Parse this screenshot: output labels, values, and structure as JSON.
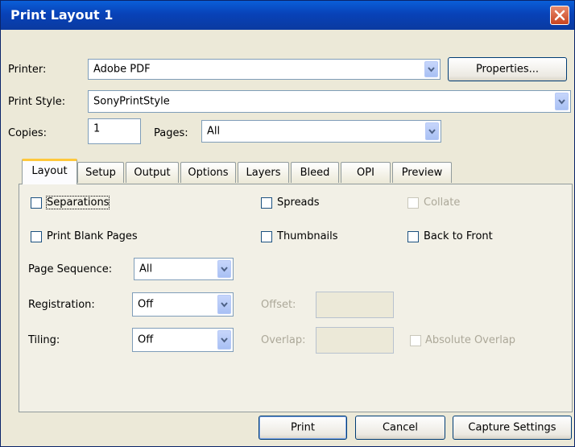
{
  "window": {
    "title": "Print Layout 1"
  },
  "printer": {
    "label": "Printer:",
    "value": "Adobe PDF",
    "properties_label": "Properties..."
  },
  "print_style": {
    "label": "Print Style:",
    "value": "SonyPrintStyle"
  },
  "copies": {
    "label": "Copies:",
    "value": "1"
  },
  "pages": {
    "label": "Pages:",
    "value": "All"
  },
  "tabs": [
    "Layout",
    "Setup",
    "Output",
    "Options",
    "Layers",
    "Bleed",
    "OPI",
    "Preview"
  ],
  "layout": {
    "separations": "Separations",
    "spreads": "Spreads",
    "collate": "Collate",
    "print_blank_pages": "Print Blank Pages",
    "thumbnails": "Thumbnails",
    "back_to_front": "Back to Front",
    "page_sequence": {
      "label": "Page Sequence:",
      "value": "All"
    },
    "registration": {
      "label": "Registration:",
      "value": "Off"
    },
    "tiling": {
      "label": "Tiling:",
      "value": "Off"
    },
    "offset_label": "Offset:",
    "overlap_label": "Overlap:",
    "absolute_overlap": "Absolute Overlap"
  },
  "buttons": {
    "print": "Print",
    "cancel": "Cancel",
    "capture": "Capture Settings"
  }
}
